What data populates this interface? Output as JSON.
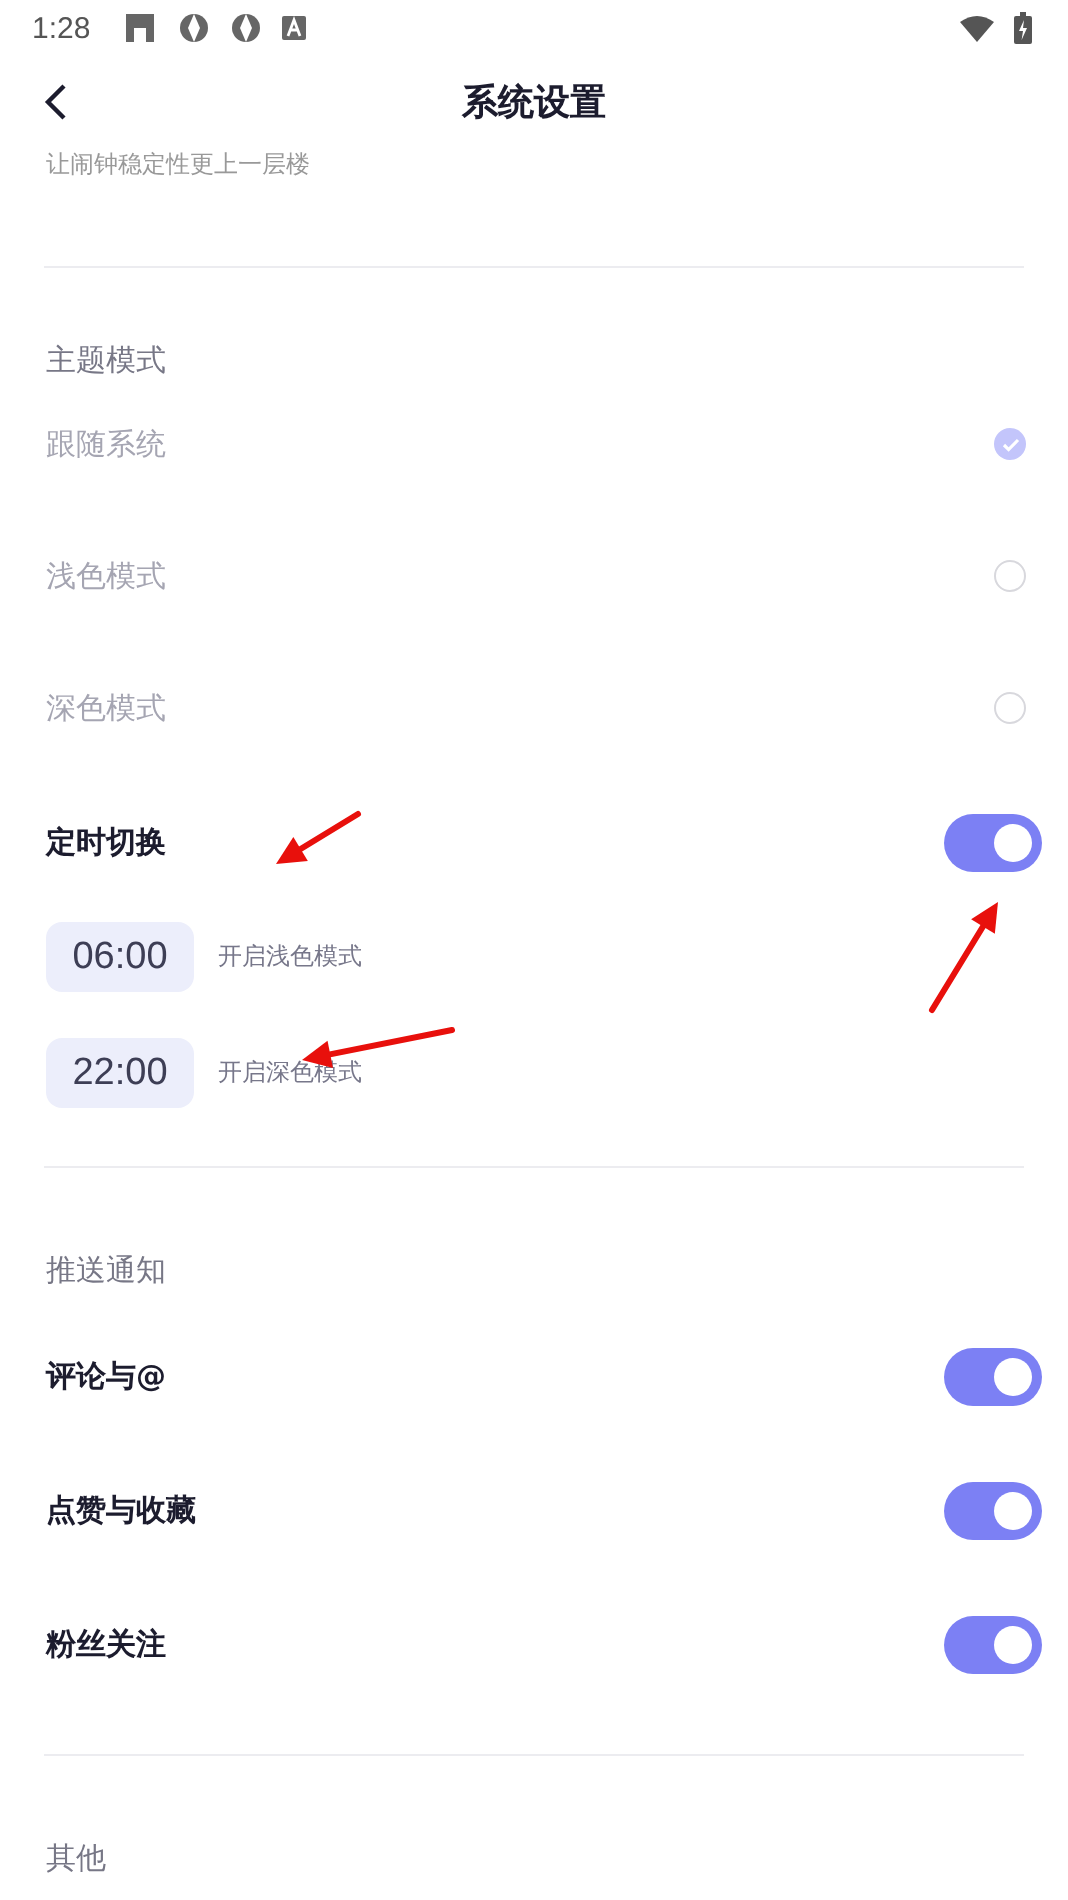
{
  "status_bar": {
    "time": "1:28"
  },
  "header": {
    "title": "系统设置"
  },
  "cut_note": "让闹钟稳定性更上一层楼",
  "theme": {
    "heading": "主题模式",
    "options": [
      {
        "label": "跟随系统",
        "selected": true
      },
      {
        "label": "浅色模式",
        "selected": false
      },
      {
        "label": "深色模式",
        "selected": false
      }
    ]
  },
  "schedule": {
    "label": "定时切换",
    "on": true,
    "times": [
      {
        "time": "06:00",
        "caption": "开启浅色模式"
      },
      {
        "time": "22:00",
        "caption": "开启深色模式"
      }
    ]
  },
  "push": {
    "heading": "推送通知",
    "items": [
      {
        "label": "评论与@",
        "on": true
      },
      {
        "label": "点赞与收藏",
        "on": true
      },
      {
        "label": "粉丝关注",
        "on": true
      }
    ]
  },
  "other": {
    "heading": "其他"
  }
}
